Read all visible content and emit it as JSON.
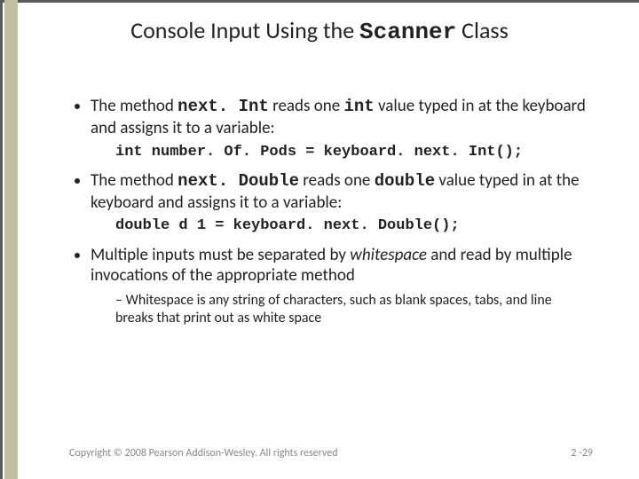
{
  "title_pre": "Console Input Using the ",
  "title_mono": "Scanner",
  "title_post": " Class",
  "bullet1_a": "The  method ",
  "bullet1_m1": "next. Int",
  "bullet1_b": " reads one ",
  "bullet1_m2": "int",
  "bullet1_c": " value typed in at the keyboard and assigns it to a variable:",
  "code1": "int number. Of. Pods = keyboard. next. Int();",
  "bullet2_a": "The method ",
  "bullet2_m1": "next. Double",
  "bullet2_b": " reads one ",
  "bullet2_m2": "double",
  "bullet2_c": " value typed in at the keyboard and assigns it to a variable:",
  "code2": "double d 1 = keyboard. next. Double();",
  "bullet3_a": "Multiple inputs must be separated by ",
  "bullet3_i": "whitespace",
  "bullet3_b": " and read by multiple invocations of the appropriate  method",
  "sub1": "Whitespace is any string of characters, such as blank spaces, tabs, and line breaks that print out as white space",
  "copyright": "Copyright © 2008 Pearson Addison-Wesley. All rights reserved",
  "pagenum": "2 -29"
}
